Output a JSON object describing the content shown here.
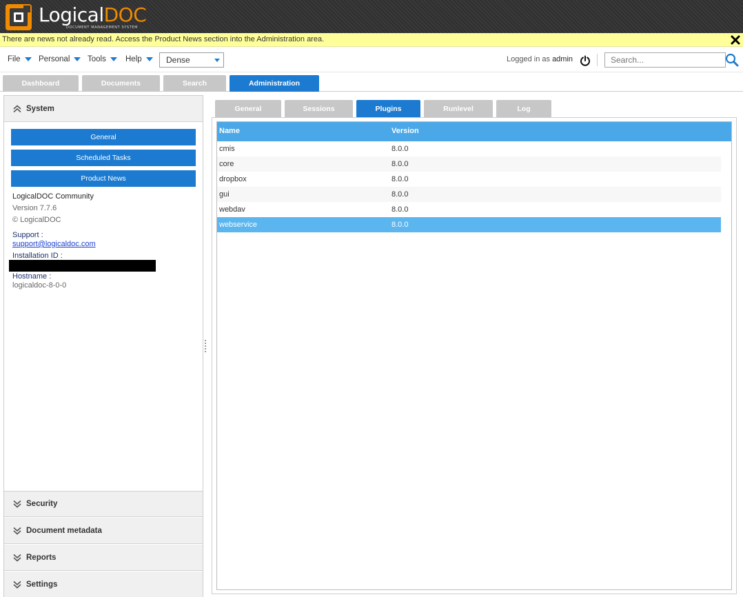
{
  "app": {
    "logo_part1": "Logical",
    "logo_part2": "DOC",
    "logo_subtitle": "DOCUMENT MANAGEMENT SYSTEM"
  },
  "news": {
    "message": "There are news not already read. Access the Product News section into the Administration area."
  },
  "menu": {
    "items": [
      "File",
      "Personal",
      "Tools",
      "Help"
    ],
    "density_value": "Dense",
    "logged_prefix": "Logged in as",
    "username": "admin",
    "search_placeholder": "Search..."
  },
  "main_tabs": [
    "Dashboard",
    "Documents",
    "Search",
    "Administration"
  ],
  "active_main_tab": "Administration",
  "left": {
    "system_title": "System",
    "buttons": [
      "General",
      "Scheduled Tasks",
      "Product News"
    ],
    "product_name": "LogicalDOC Community",
    "version": "Version 7.7.6",
    "copyright": "© LogicalDOC",
    "support_label": "Support :",
    "support_email": "support@logicaldoc.com",
    "installation_label": "Installation ID :",
    "hostname_label": "Hostname :",
    "hostname": "logicaldoc-8-0-0",
    "collapsed_sections": [
      "Security",
      "Document metadata",
      "Reports",
      "Settings"
    ]
  },
  "right": {
    "tabs": [
      "General",
      "Sessions",
      "Plugins",
      "Runlevel",
      "Log"
    ],
    "active_tab": "Plugins",
    "columns": [
      "Name",
      "Version"
    ],
    "rows": [
      {
        "name": "cmis",
        "version": "8.0.0"
      },
      {
        "name": "core",
        "version": "8.0.0"
      },
      {
        "name": "dropbox",
        "version": "8.0.0"
      },
      {
        "name": "gui",
        "version": "8.0.0"
      },
      {
        "name": "webdav",
        "version": "8.0.0"
      },
      {
        "name": "webservice",
        "version": "8.0.0"
      }
    ],
    "selected_row": "webservice"
  },
  "colors": {
    "accent": "#1c7bd0",
    "header_blue": "#4aa8e8",
    "selection": "#5bb6ef",
    "logo_orange": "#f08a00",
    "news_bg": "#ffff99"
  }
}
